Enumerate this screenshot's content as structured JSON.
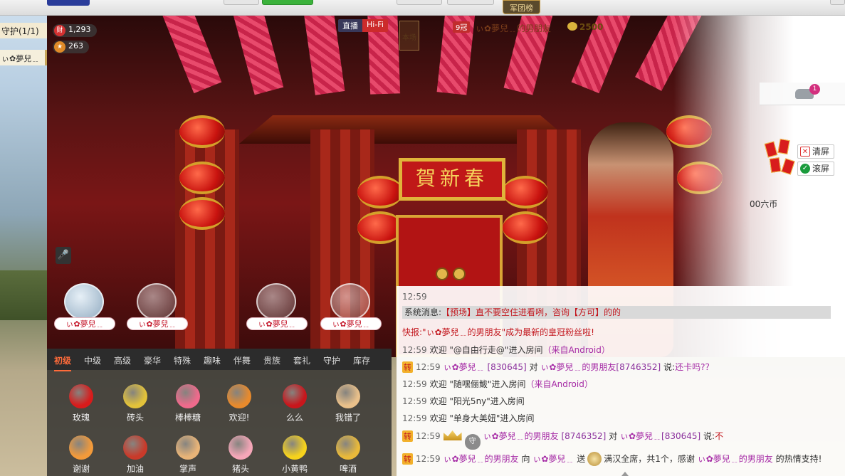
{
  "top": {
    "legion_button": "军团榜"
  },
  "left": {
    "guard_title": "守护(1/1)",
    "guard_name": "ぃ✿夢兒﹎"
  },
  "stats": {
    "wealth": "1,293",
    "fans": "263"
  },
  "stream_mode": {
    "live": "直播",
    "hifi": "Hi-Fi"
  },
  "room": {
    "this_room": "本场"
  },
  "anchor": {
    "rank": "9冠",
    "name": "ぃ✿夢兒﹎的男朋友",
    "coins": "2500"
  },
  "stage": {
    "plaque": "賀新春"
  },
  "right_panel": {
    "car_count": "1",
    "clear_label": "清屏",
    "scroll_label": "滚屏",
    "coin_tip": "00六币"
  },
  "seats": [
    {
      "name": "ぃ✿夢兒﹎"
    },
    {
      "name": "ぃ✿夢兒﹎"
    },
    {
      "name": "ぃ✿夢兒﹎"
    },
    {
      "name": "ぃ✿夢兒﹎"
    }
  ],
  "chat": {
    "line0_time": "12:59",
    "system_label": "系统消息:",
    "system_text": "【预场】直不要空住进看咧，咨询【方可】的的",
    "flash_label": "快报:",
    "flash_text": "\"ぃ✿夢兒﹎的男朋友\"成为最新的皇冠粉丝啦!",
    "messages": [
      {
        "time": "12:59",
        "text": "欢迎 \"@自由行走@\"进入房间",
        "src": "（来自Android）"
      },
      {
        "time": "12:59",
        "sender": "ぃ✿夢兒﹎",
        "sender_id": "[830645]",
        "to": "对",
        "target": "ぃ✿夢兒﹎的男朋友",
        "target_id": "[8746352]",
        "say": "说:",
        "content": "还卡吗?？"
      },
      {
        "time": "12:59",
        "text": "欢迎 \"随嘿俪鲅\"进入房间",
        "src": "（来自Android）"
      },
      {
        "time": "12:59",
        "text": "欢迎 \"阳光5ny\"进入房间",
        "src": ""
      },
      {
        "time": "12:59",
        "text": "欢迎 \"单身大美妞\"进入房间",
        "src": ""
      },
      {
        "time": "12:59",
        "sender": "ぃ✿夢兒﹎的男朋友",
        "sender_id": "[8746352]",
        "to": "对",
        "target": "ぃ✿夢兒﹎",
        "target_id": "[830645]",
        "say": "说:",
        "content": "不",
        "shield": "守"
      },
      {
        "time": "12:59",
        "sender": "ぃ✿夢兒﹎的男朋友",
        "to": "向",
        "target": "ぃ✿夢兒﹎",
        "send": "送",
        "gift_text": "满汉全席，共1个，感谢",
        "thank_target": "ぃ✿夢兒﹎的男朋友",
        "thank_tail": "的热情支持!"
      }
    ],
    "zhuan_tag": "转"
  },
  "gift_tabs": [
    "初级",
    "中级",
    "高级",
    "豪华",
    "特殊",
    "趣味",
    "伴舞",
    "贵族",
    "套礼",
    "守护",
    "库存"
  ],
  "gifts": [
    {
      "label": "玫瑰",
      "color": "#d81b1b"
    },
    {
      "label": "砖头",
      "color": "#e2c23a"
    },
    {
      "label": "棒棒糖",
      "color": "#ef6a8c"
    },
    {
      "label": "欢迎!",
      "color": "#e88a2c"
    },
    {
      "label": "么么",
      "color": "#c8161c"
    },
    {
      "label": "我错了",
      "color": "#e9c08a"
    },
    {
      "label": "谢谢",
      "color": "#f39a3a"
    },
    {
      "label": "加油",
      "color": "#c93a2a"
    },
    {
      "label": "掌声",
      "color": "#e8b478"
    },
    {
      "label": "猪头",
      "color": "#f5a6b8"
    },
    {
      "label": "小黄鸭",
      "color": "#f6d21c"
    },
    {
      "label": "啤酒",
      "color": "#e9b93a"
    }
  ]
}
